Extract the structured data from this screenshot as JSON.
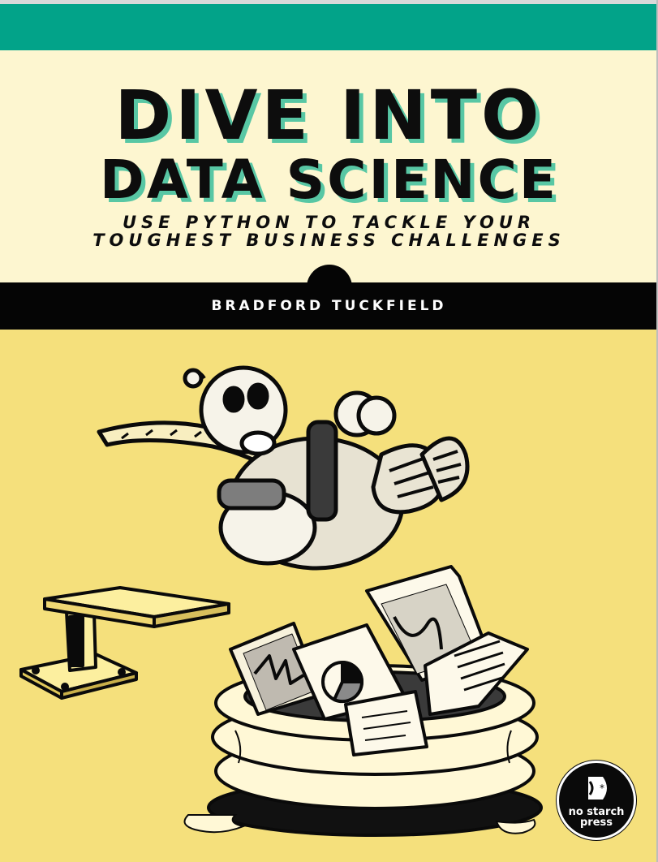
{
  "cover": {
    "title_line_1": "DIVE INTO",
    "title_line_2": "DATA SCIENCE",
    "subtitle_line_1": "USE PYTHON TO TACKLE YOUR",
    "subtitle_line_2": "TOUGHEST BUSINESS CHALLENGES",
    "author": "BRADFORD TUCKFIELD",
    "publisher_line_1": "no starch",
    "publisher_line_2": "press"
  },
  "colors": {
    "teal_band": "#02a389",
    "title_shadow": "#58c7a4",
    "cream": "#fdf6d0",
    "yellow": "#f5e07c",
    "black": "#050505"
  },
  "icons": [
    "robot-illustration",
    "diving-board-illustration",
    "inflatable-pool-illustration",
    "chart-papers-illustration",
    "no-starch-press-logo-icon"
  ]
}
